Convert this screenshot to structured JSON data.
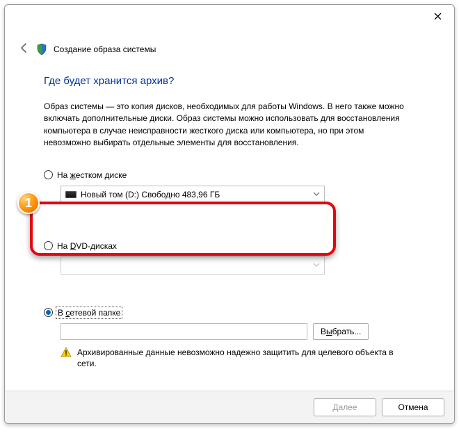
{
  "window": {
    "title": "Создание образа системы"
  },
  "content": {
    "question": "Где будет хранится архив?",
    "description": "Образ системы — это копия дисков, необходимых для работы Windows. В него также можно включать дополнительные диски. Образ системы можно использовать для восстановления компьютера в случае неисправности жесткого диска или компьютера, но при этом невозможно выбирать отдельные элементы для восстановления."
  },
  "options": {
    "hdd": {
      "label_prefix": "На ",
      "label_accessed": "ж",
      "label_suffix": "естком диске",
      "checked": false,
      "combo_value": "Новый том (D:)  Свободно 483,96 ГБ"
    },
    "dvd": {
      "label_prefix": "На ",
      "label_accessed": "D",
      "label_suffix": "VD-дисках",
      "checked": false
    },
    "net": {
      "label_prefix": "В ",
      "label_accessed": "с",
      "label_suffix": "етевой папке",
      "checked": true,
      "browse_label_pre": "В",
      "browse_label_acc": "ы",
      "browse_label_suf": "брать...",
      "warning": "Архивированные данные невозможно надежно защитить для целевого объекта в сети."
    }
  },
  "footer": {
    "next": "Далее",
    "cancel": "Отмена"
  },
  "annotation": {
    "badge1": "1"
  }
}
